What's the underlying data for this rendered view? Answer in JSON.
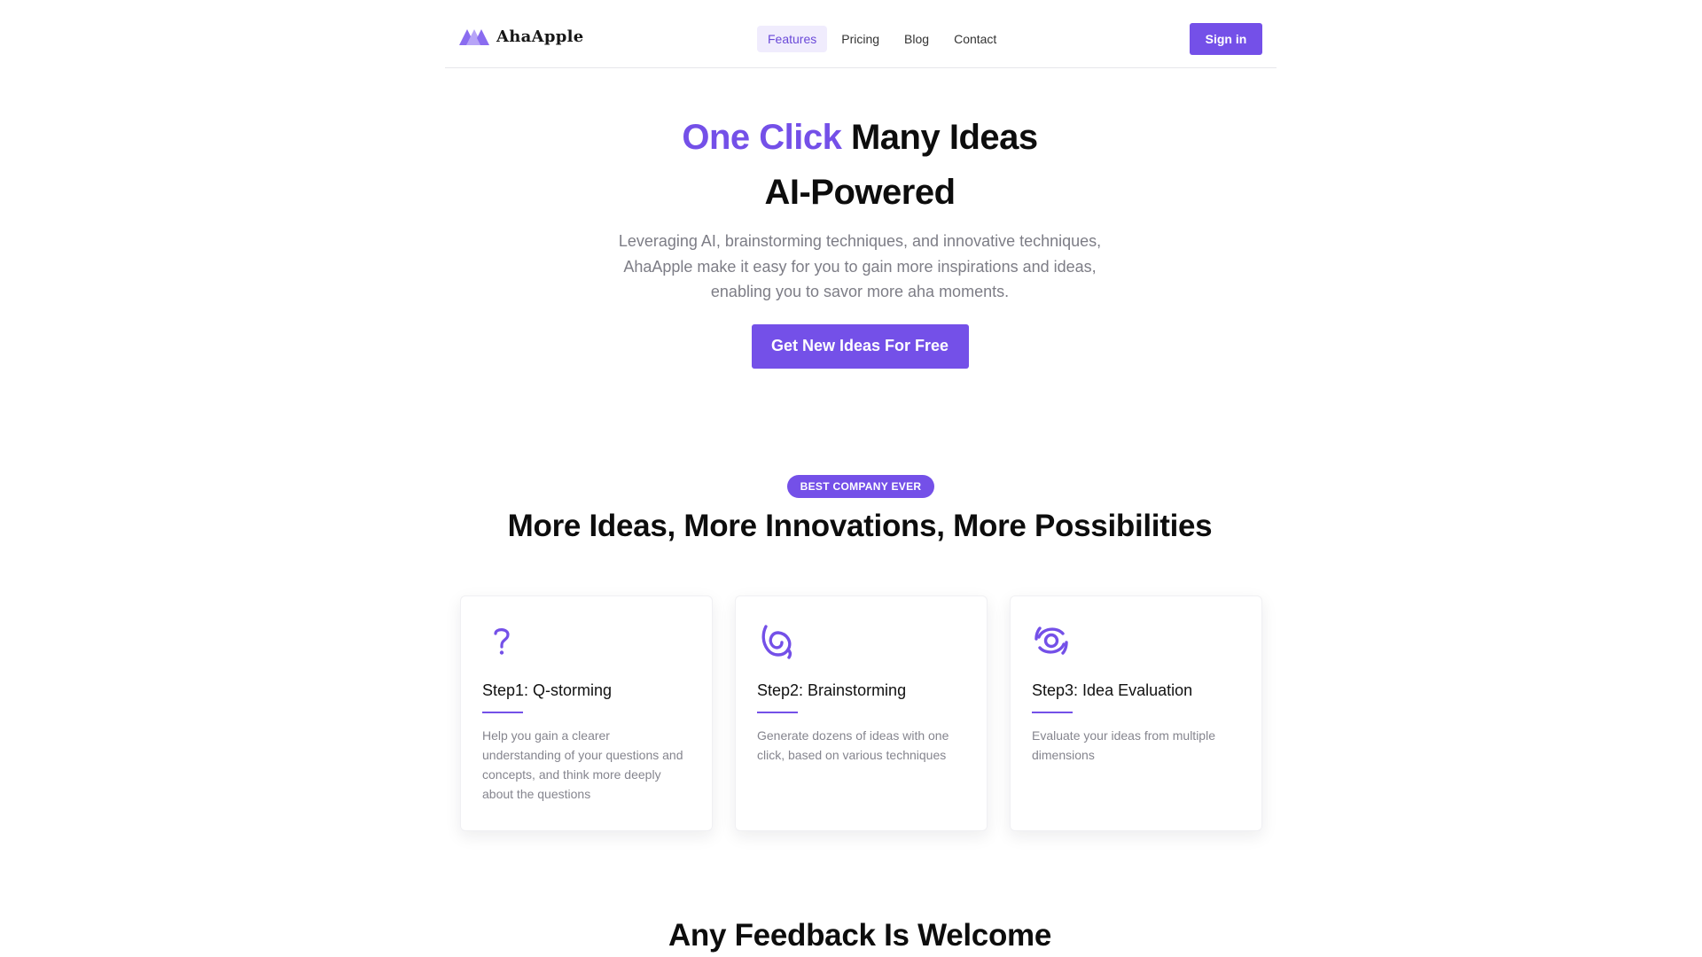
{
  "brand": {
    "name": "AhaApple",
    "accent_color": "#7450e8"
  },
  "nav": {
    "items": [
      {
        "label": "Features",
        "active": true
      },
      {
        "label": "Pricing",
        "active": false
      },
      {
        "label": "Blog",
        "active": false
      },
      {
        "label": "Contact",
        "active": false
      }
    ],
    "signin_label": "Sign in"
  },
  "hero": {
    "title_accent": "One Click",
    "title_rest": "Many Ideas",
    "subtitle": "AI-Powered",
    "description": "Leveraging AI, brainstorming techniques, and innovative techniques, AhaApple make it easy for you to gain more inspirations and ideas, enabling you to savor more aha moments.",
    "cta_label": "Get New Ideas For Free"
  },
  "features": {
    "badge": "BEST COMPANY EVER",
    "title": "More Ideas, More Innovations, More Possibilities",
    "cards": [
      {
        "icon": "question-mark-icon",
        "title": "Step1: Q-storming",
        "description": "Help you gain a clearer understanding of your questions and concepts, and think more deeply about the questions"
      },
      {
        "icon": "spiral-target-icon",
        "title": "Step2: Brainstorming",
        "description": "Generate dozens of ideas with one click, based on various techniques"
      },
      {
        "icon": "eye-target-icon",
        "title": "Step3: Idea Evaluation",
        "description": "Evaluate your ideas from multiple dimensions"
      }
    ]
  },
  "feedback": {
    "title": "Any Feedback Is Welcome"
  }
}
